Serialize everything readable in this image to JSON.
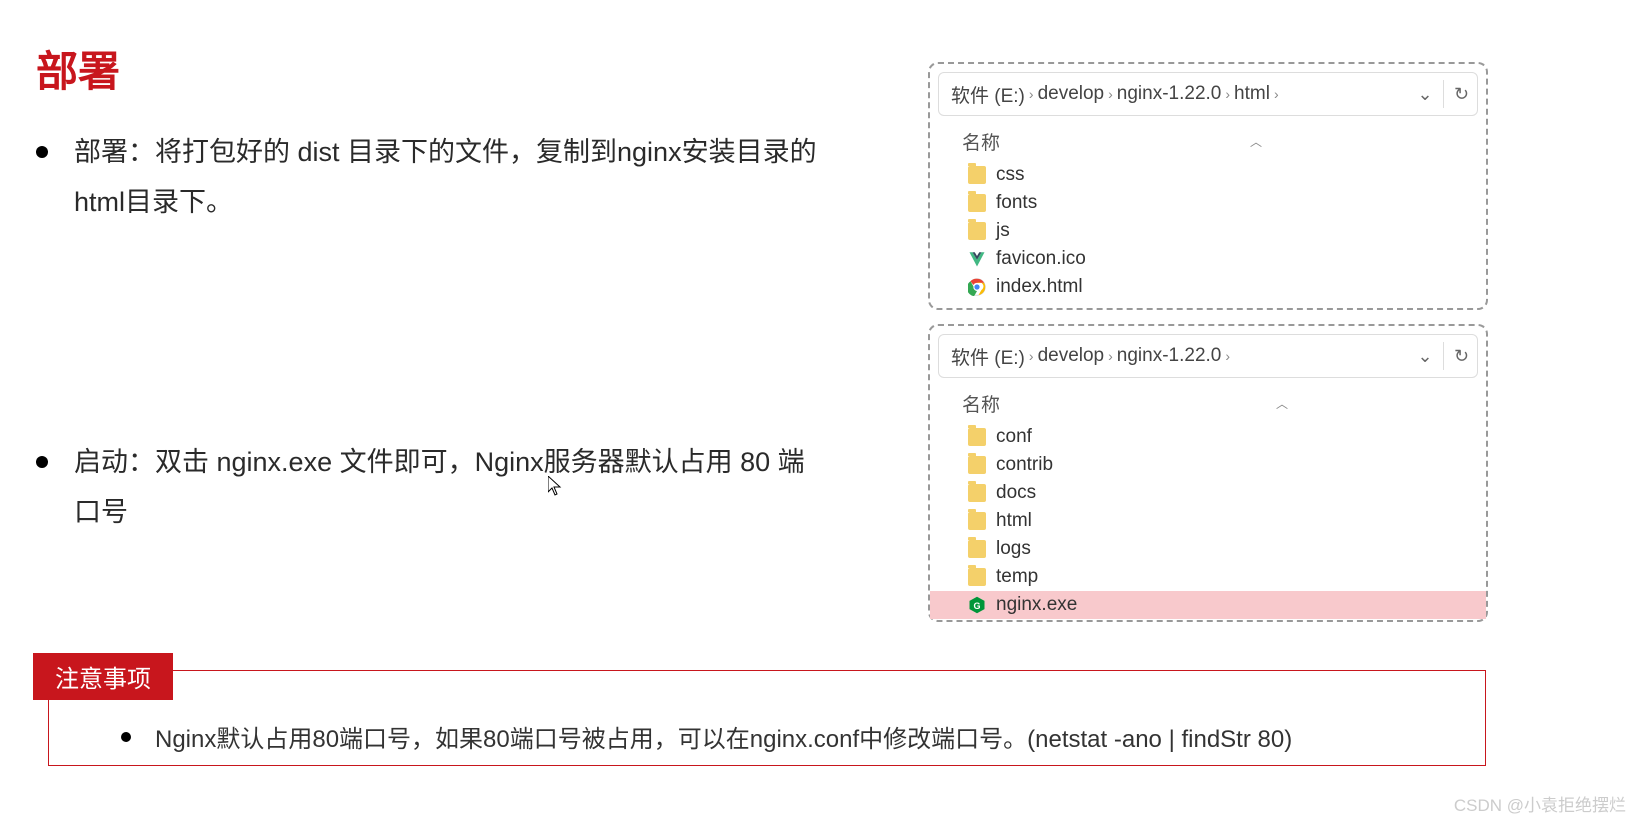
{
  "title": "部署",
  "bullets": [
    "部署：将打包好的 dist 目录下的文件，复制到nginx安装目录的html目录下。",
    "启动：双击 nginx.exe 文件即可，Nginx服务器默认占用 80 端口号"
  ],
  "explorer1": {
    "breadcrumb": [
      "软件 (E:)",
      "develop",
      "nginx-1.22.0",
      "html"
    ],
    "column_header": "名称",
    "items": [
      {
        "name": "css",
        "type": "folder"
      },
      {
        "name": "fonts",
        "type": "folder"
      },
      {
        "name": "js",
        "type": "folder"
      },
      {
        "name": "favicon.ico",
        "type": "vue"
      },
      {
        "name": "index.html",
        "type": "chrome"
      }
    ]
  },
  "explorer2": {
    "breadcrumb": [
      "软件 (E:)",
      "develop",
      "nginx-1.22.0"
    ],
    "column_header": "名称",
    "items": [
      {
        "name": "conf",
        "type": "folder"
      },
      {
        "name": "contrib",
        "type": "folder"
      },
      {
        "name": "docs",
        "type": "folder"
      },
      {
        "name": "html",
        "type": "folder"
      },
      {
        "name": "logs",
        "type": "folder"
      },
      {
        "name": "temp",
        "type": "folder"
      },
      {
        "name": "nginx.exe",
        "type": "nginx",
        "highlighted": true
      }
    ]
  },
  "notice": {
    "tag": "注意事项",
    "text": "Nginx默认占用80端口号，如果80端口号被占用，可以在nginx.conf中修改端口号。(netstat -ano | findStr  80)"
  },
  "watermark": "CSDN @小袁拒绝摆烂"
}
